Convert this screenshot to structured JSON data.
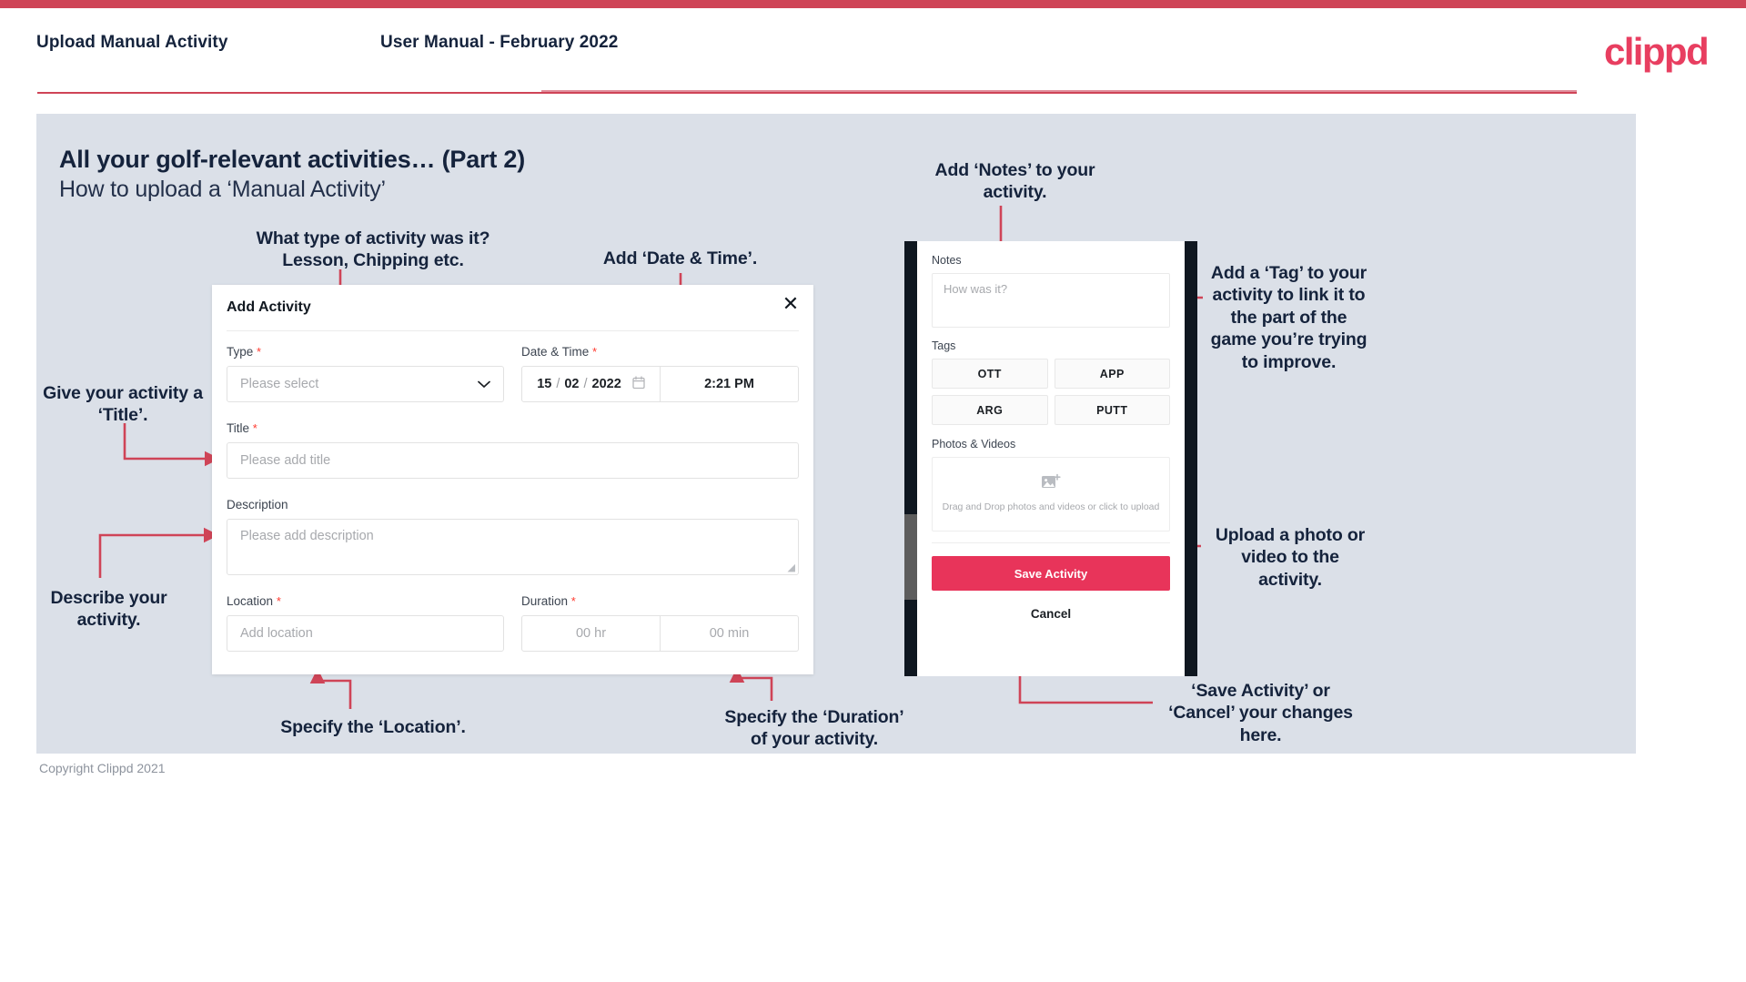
{
  "header": {
    "title": "Upload Manual Activity",
    "subtitle": "User Manual - February 2022",
    "logo": "clippd"
  },
  "slide": {
    "title": "All your golf-relevant activities… (Part 2)",
    "subtitle": "How to upload a ‘Manual Activity’",
    "footer": "Copyright Clippd 2021"
  },
  "annotations": {
    "type": "What type of activity was it?\nLesson, Chipping etc.",
    "datetime": "Add ‘Date & Time’.",
    "title": "Give your activity a\n‘Title’.",
    "description": "Describe your\nactivity.",
    "location": "Specify the ‘Location’.",
    "duration": "Specify the ‘Duration’\nof your activity.",
    "notes": "Add ‘Notes’ to your\nactivity.",
    "tags": "Add a ‘Tag’ to your\nactivity to link it to\nthe part of the\ngame you’re trying\nto improve.",
    "upload": "Upload a photo or\nvideo to the activity.",
    "save_cancel": "‘Save Activity’ or\n‘Cancel’ your changes\nhere."
  },
  "dialog": {
    "title": "Add Activity",
    "close": "✕",
    "fields": {
      "type": {
        "label": "Type",
        "required": "*",
        "placeholder": "Please select",
        "caret": "⌄"
      },
      "datetime": {
        "label": "Date & Time",
        "required": "*",
        "day": "15",
        "month": "02",
        "year": "2022",
        "sep": "/",
        "time": "2:21 PM"
      },
      "title": {
        "label": "Title",
        "required": "*",
        "placeholder": "Please add title"
      },
      "description": {
        "label": "Description",
        "required": "",
        "placeholder": "Please add description"
      },
      "location": {
        "label": "Location",
        "required": "*",
        "placeholder": "Add location"
      },
      "duration": {
        "label": "Duration",
        "required": "*",
        "hours_placeholder": "00 hr",
        "minutes_placeholder": "00 min"
      }
    }
  },
  "phone": {
    "notes_label": "Notes",
    "notes_placeholder": "How was it?",
    "tags_label": "Tags",
    "tags": [
      "OTT",
      "APP",
      "ARG",
      "PUTT"
    ],
    "photos_label": "Photos & Videos",
    "dropzone_text": "Drag and Drop photos and videos or click to upload",
    "save_label": "Save Activity",
    "cancel_label": "Cancel"
  },
  "colors": {
    "brand_pink": "#e8345a",
    "accent_rule": "#cf4457",
    "panel_bg": "#dbe0e8",
    "text_dark": "#15233c"
  }
}
